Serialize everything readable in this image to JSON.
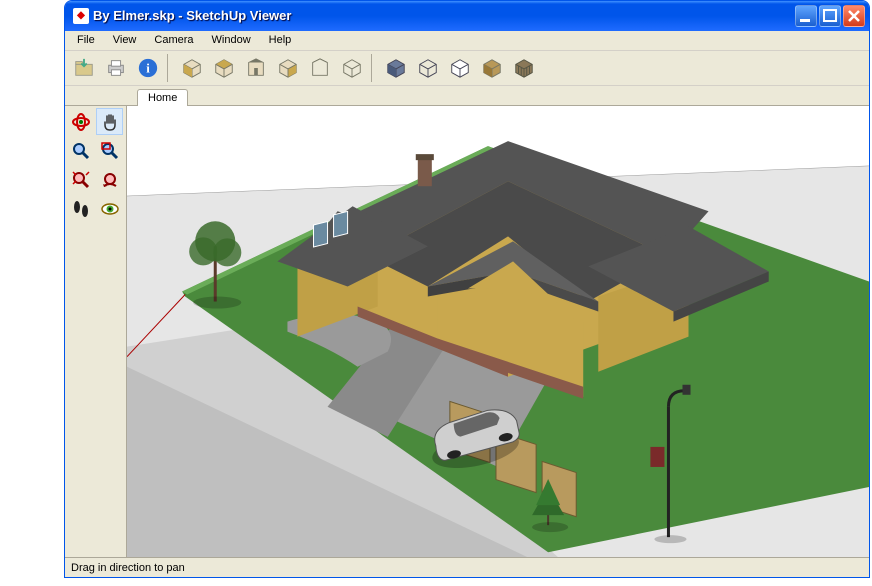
{
  "titlebar": {
    "title": "By Elmer.skp - SketchUp Viewer"
  },
  "menubar": {
    "items": [
      "File",
      "View",
      "Camera",
      "Window",
      "Help"
    ]
  },
  "toolbar_icons": [
    "open-file-icon",
    "print-icon",
    "info-icon",
    "iso-view-icon",
    "cube-top-icon",
    "cube-front-icon",
    "cube-wire-icon",
    "cube-right-icon",
    "cube-back-icon",
    "shade-textured-icon",
    "shade-wire-icon",
    "shade-hidden-icon",
    "shade-mono-icon",
    "shade-xray-icon"
  ],
  "tabs": {
    "active": "Home"
  },
  "side_toolbar_icons": [
    "orbit-icon",
    "pan-icon",
    "zoom-icon",
    "zoom-window-icon",
    "zoom-extents-icon",
    "previous-view-icon",
    "walk-icon",
    "look-around-icon"
  ],
  "statusbar": {
    "hint": "Drag in direction to pan"
  },
  "colors": {
    "titlebar_blue": "#0055ea",
    "close_red": "#d43b1a",
    "chrome_bg": "#ece9d8",
    "grass": "#4a8a3c",
    "roof": "#545454",
    "wall": "#c9a84e",
    "driveway": "#9a9a9a",
    "street": "#bfbfbf"
  }
}
